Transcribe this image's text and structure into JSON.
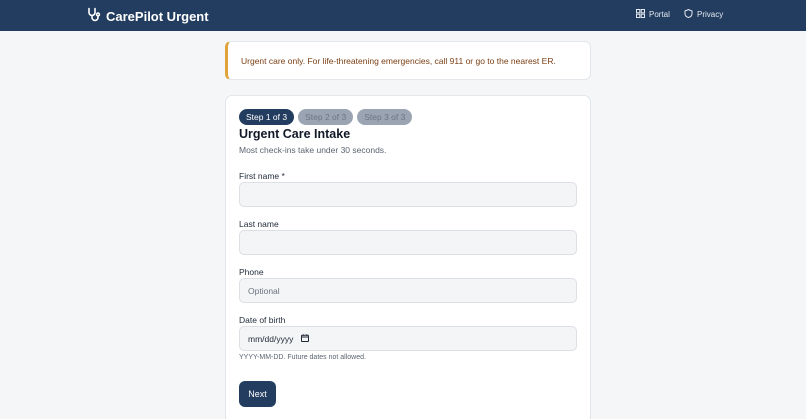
{
  "header": {
    "brand": "CarePilot Urgent",
    "nav": [
      {
        "label": "Portal",
        "icon": "grid-icon"
      },
      {
        "label": "Privacy",
        "icon": "shield-icon"
      }
    ]
  },
  "alert": {
    "text": "Urgent care only. For life-threatening emergencies, call 911 or go to the nearest ER."
  },
  "form": {
    "steps": [
      "Step 1 of 3",
      "Step 2 of 3",
      "Step 3 of 3"
    ],
    "active_step": 1,
    "title": "Urgent Care Intake",
    "subtitle": "Most check-ins take under 30 seconds.",
    "fields": {
      "first_name": {
        "label": "First name *",
        "value": "",
        "placeholder": ""
      },
      "last_name": {
        "label": "Last name",
        "value": "",
        "placeholder": ""
      },
      "phone": {
        "label": "Phone",
        "value": "",
        "placeholder": "Optional"
      },
      "dob": {
        "label": "Date of birth",
        "value": "mm/dd/yyyy",
        "hint": "YYYY-MM-DD. Future dates not allowed."
      }
    },
    "next_label": "Next"
  },
  "colors": {
    "header_bg": "#233d60",
    "alert_accent": "#e0a33a",
    "alert_text": "#7a3e14",
    "primary": "#233d60"
  }
}
